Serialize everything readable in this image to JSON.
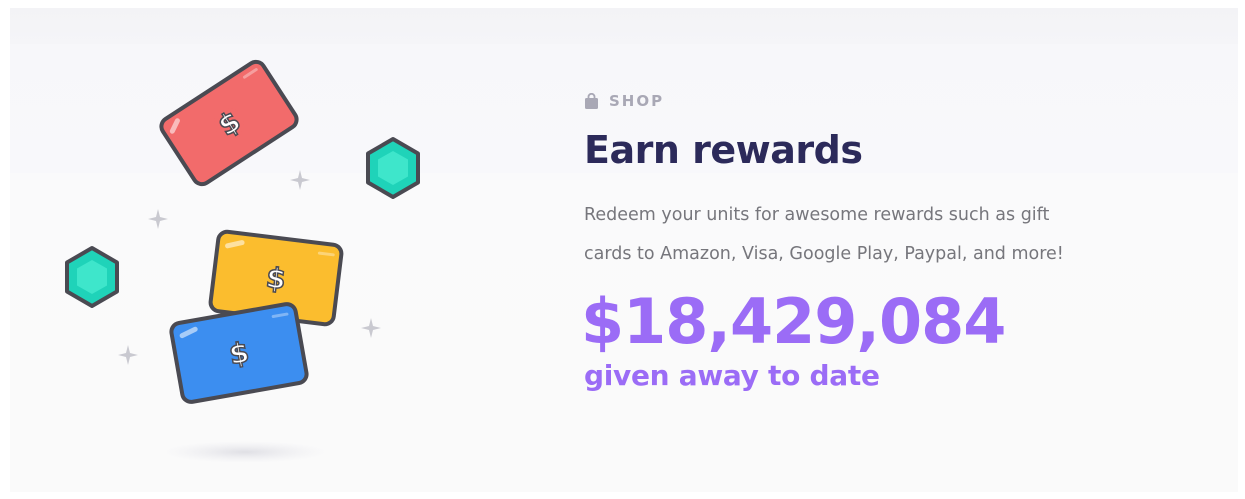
{
  "section": {
    "eyebrow_icon": "shopping-bag-icon",
    "eyebrow": "SHOP",
    "title": "Earn rewards",
    "description_line1": "Redeem your units for awesome rewards such as gift",
    "description_line2": "cards to Amazon, Visa, Google Play, Paypal, and more!",
    "amount": "$18,429,084",
    "amount_caption": "given away to date"
  },
  "illustration": {
    "icons": [
      "red-gift-card-icon",
      "yellow-gift-card-icon",
      "blue-gift-card-icon",
      "teal-hexagon-gem-icon",
      "sparkle-icon"
    ],
    "card_symbol": "$"
  },
  "colors": {
    "title": "#2c2a5a",
    "accent": "#9b6cf6",
    "muted": "#a9a8b5",
    "body_text": "#76767c",
    "card_red": "#f26b6b",
    "card_yellow": "#fbbd2e",
    "card_blue": "#3c8ef0",
    "gem_teal": "#1fd3b9",
    "outline": "#4a4a52"
  }
}
